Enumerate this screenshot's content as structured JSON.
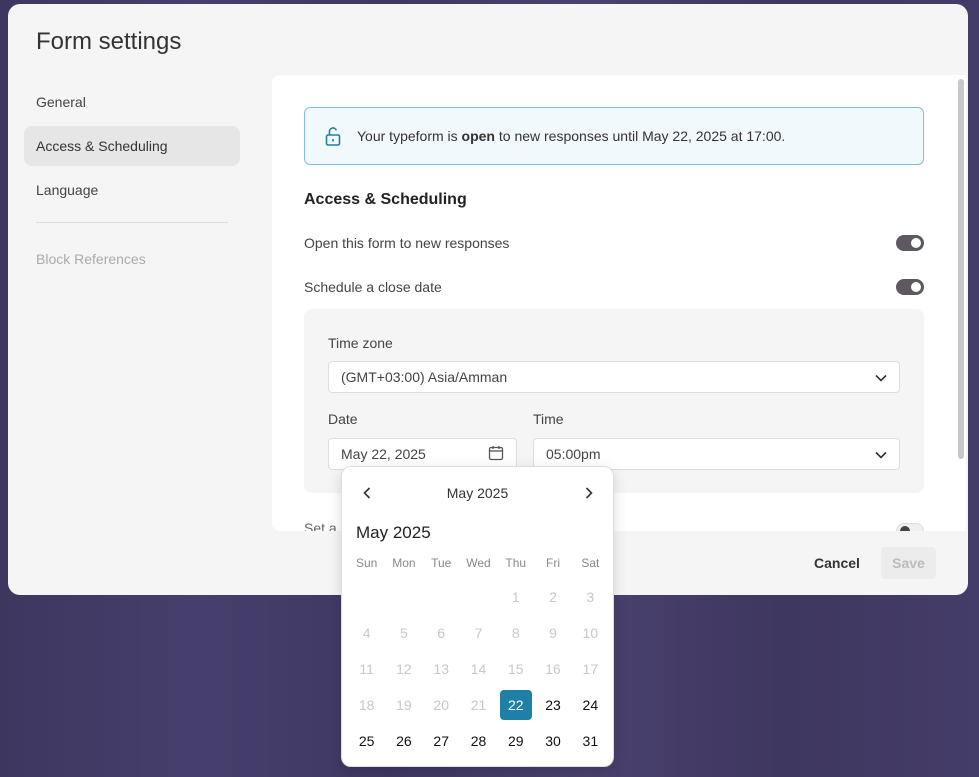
{
  "modal": {
    "title": "Form settings"
  },
  "nav": {
    "items": [
      {
        "label": "General"
      },
      {
        "label": "Access & Scheduling"
      },
      {
        "label": "Language"
      }
    ],
    "secondary": "Block References"
  },
  "notice": {
    "prefix": "Your typeform is ",
    "bold": "open",
    "suffix": " to new responses until May 22, 2025 at 17:00."
  },
  "section": {
    "title": "Access & Scheduling"
  },
  "settings": {
    "open_label": "Open this form to new responses",
    "schedule_label": "Schedule a close date"
  },
  "panel": {
    "timezone_label": "Time zone",
    "timezone_value": "(GMT+03:00) Asia/Amman",
    "date_label": "Date",
    "date_value": "May 22, 2025",
    "time_label": "Time",
    "time_value": "05:00pm"
  },
  "cut_text": "Set a r",
  "footer": {
    "cancel": "Cancel",
    "save": "Save"
  },
  "calendar": {
    "header_month": "May 2025",
    "sub_month": "May 2025",
    "weekdays": [
      "Sun",
      "Mon",
      "Tue",
      "Wed",
      "Thu",
      "Fri",
      "Sat"
    ],
    "weeks": [
      [
        "",
        "",
        "",
        "",
        "1",
        "2",
        "3"
      ],
      [
        "4",
        "5",
        "6",
        "7",
        "8",
        "9",
        "10"
      ],
      [
        "11",
        "12",
        "13",
        "14",
        "15",
        "16",
        "17"
      ],
      [
        "18",
        "19",
        "20",
        "21",
        "22",
        "23",
        "24"
      ],
      [
        "25",
        "26",
        "27",
        "28",
        "29",
        "30",
        "31"
      ]
    ],
    "selected": "22",
    "accent": "#1f7fa6"
  }
}
